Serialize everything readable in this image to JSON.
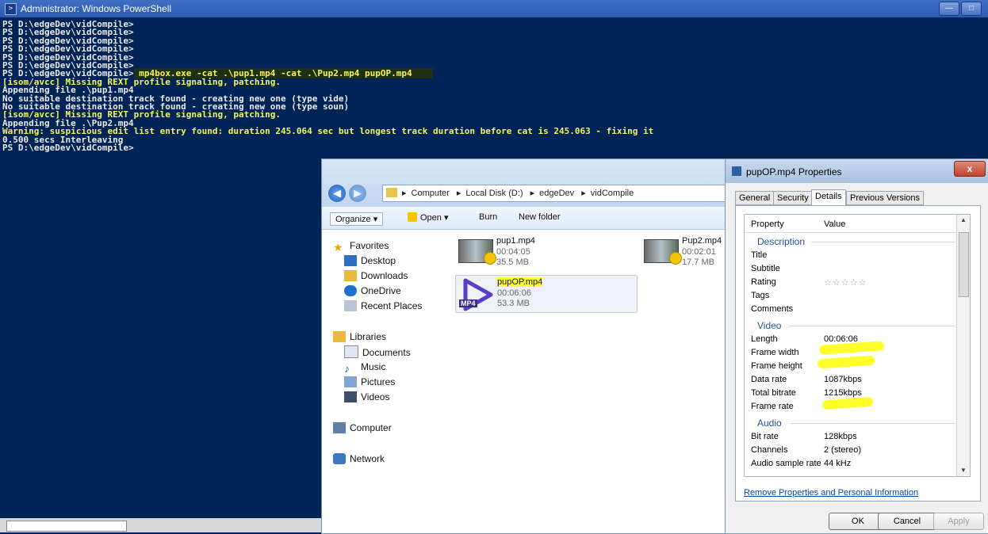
{
  "powershell": {
    "title": "Administrator: Windows PowerShell",
    "lines": [
      {
        "text": "PS D:\\edgeDev\\vidCompile>",
        "style": "normal"
      },
      {
        "text": "PS D:\\edgeDev\\vidCompile>",
        "style": "normal"
      },
      {
        "text": "PS D:\\edgeDev\\vidCompile>",
        "style": "normal"
      },
      {
        "text": "PS D:\\edgeDev\\vidCompile>",
        "style": "normal"
      },
      {
        "text": "PS D:\\edgeDev\\vidCompile>",
        "style": "normal"
      },
      {
        "text": "PS D:\\edgeDev\\vidCompile>",
        "style": "normal"
      },
      {
        "text": "PS D:\\edgeDev\\vidCompile>",
        "style": "normal",
        "cmd": " mp4box.exe -cat .\\pup1.mp4 -cat .\\Pup2.mp4 pupOP.mp4    "
      },
      {
        "text": "[isom/avcc] Missing REXT profile signaling, patching.",
        "style": "warn"
      },
      {
        "text": "Appending file .\\pup1.mp4",
        "style": "normal"
      },
      {
        "text": "No suitable destination track found - creating new one (type vide)",
        "style": "normal"
      },
      {
        "text": "No suitable destination track found - creating new one (type soun)",
        "style": "normal"
      },
      {
        "text": "[isom/avcc] Missing REXT profile signaling, patching.",
        "style": "warn"
      },
      {
        "text": "Appending file .\\Pup2.mp4",
        "style": "normal"
      },
      {
        "text": "Warning: suspicious edit list entry found: duration 245.064 sec but longest track duration before cat is 245.063 - fixing it",
        "style": "warn"
      },
      {
        "text": "0.500 secs Interleaving",
        "style": "normal"
      },
      {
        "text": "PS D:\\edgeDev\\vidCompile>",
        "style": "normal"
      }
    ]
  },
  "explorer": {
    "breadcrumb": [
      "Computer",
      "Local Disk (D:)",
      "edgeDev",
      "vidCompile"
    ],
    "toolbar": {
      "organize": "Organize ▾",
      "open": "Open ▾",
      "burn": "Burn",
      "new_folder": "New folder"
    },
    "nav": {
      "favorites": "Favorites",
      "desktop": "Desktop",
      "downloads": "Downloads",
      "onedrive": "OneDrive",
      "recent": "Recent Places",
      "libraries": "Libraries",
      "documents": "Documents",
      "music": "Music",
      "pictures": "Pictures",
      "videos": "Videos",
      "computer": "Computer",
      "network": "Network"
    },
    "files": [
      {
        "name": "pup1.mp4",
        "duration": "00:04:05",
        "size": "35.5 MB"
      },
      {
        "name": "Pup2.mp4",
        "duration": "00:02:01",
        "size": "17.7 MB"
      },
      {
        "name": "pupOP.mp4",
        "duration": "00:06:06",
        "size": "53.3 MB",
        "badge": "MP4"
      }
    ]
  },
  "properties": {
    "title": "pupOP.mp4 Properties",
    "close": "x",
    "tabs": [
      "General",
      "Security",
      "Details",
      "Previous Versions"
    ],
    "active_tab": "Details",
    "columns": {
      "property": "Property",
      "value": "Value"
    },
    "sections": {
      "description": "Description",
      "video": "Video",
      "audio": "Audio"
    },
    "rows": {
      "title": "Title",
      "subtitle": "Subtitle",
      "rating": "Rating",
      "rating_stars": "☆☆☆☆☆",
      "tags": "Tags",
      "comments": "Comments",
      "length": "Length",
      "length_value": "00:06:06",
      "frame_width": "Frame width",
      "frame_height": "Frame height",
      "data_rate": "Data rate",
      "data_rate_value": "1087kbps",
      "total_bitrate": "Total bitrate",
      "total_bitrate_value": "1215kbps",
      "frame_rate": "Frame rate",
      "bit_rate": "Bit rate",
      "bit_rate_value": "128kbps",
      "channels": "Channels",
      "channels_value": "2 (stereo)",
      "sample_rate": "Audio sample rate",
      "sample_rate_value": "44 kHz"
    },
    "remove_link": "Remove Properties and Personal Information",
    "buttons": {
      "ok": "OK",
      "cancel": "Cancel",
      "apply": "Apply"
    }
  },
  "colors": {
    "console_bg": "#012456",
    "highlight": "#ffff33",
    "warning_text": "#f5f55a"
  }
}
